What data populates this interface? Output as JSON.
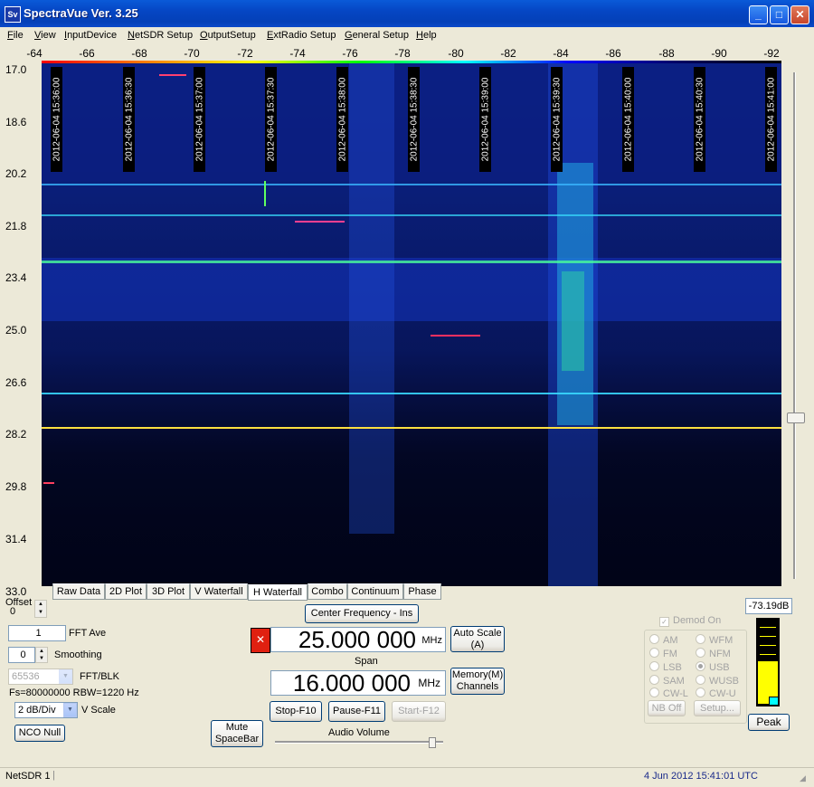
{
  "window": {
    "title": "SpectraVue Ver. 3.25",
    "icon_text": "Sv"
  },
  "menu": [
    {
      "key": "F",
      "rest": "ile"
    },
    {
      "key": "V",
      "rest": "iew"
    },
    {
      "key": "I",
      "rest": "nputDevice"
    },
    {
      "key": "N",
      "rest": "etSDR Setup"
    },
    {
      "key": "O",
      "rest": "utputSetup"
    },
    {
      "key": "E",
      "rest": "xtRadio Setup"
    },
    {
      "key": "G",
      "rest": "eneral Setup"
    },
    {
      "key": "H",
      "rest": "elp"
    }
  ],
  "db_axis": [
    "-64",
    "-66",
    "-68",
    "-70",
    "-72",
    "-74",
    "-76",
    "-78",
    "-80",
    "-82",
    "-84",
    "-86",
    "-88",
    "-90",
    "-92"
  ],
  "freq_axis": [
    "17.0",
    "18.6",
    "20.2",
    "21.8",
    "23.4",
    "25.0",
    "26.6",
    "28.2",
    "29.8",
    "31.4",
    "33.0"
  ],
  "timestamps": [
    "2012-06-04 15:36:00",
    "2012-06-04 15:36:30",
    "2012-06-04 15:37:00",
    "2012-06-04 15:37:30",
    "2012-06-04 15:38:00",
    "2012-06-04 15:38:30",
    "2012-06-04 15:39:00",
    "2012-06-04 15:39:30",
    "2012-06-04 15:40:00",
    "2012-06-04 15:40:30",
    "2012-06-04 15:41:00"
  ],
  "tabs": [
    "Raw Data",
    "2D Plot",
    "3D Plot",
    "V Waterfall",
    "H Waterfall",
    "Combo",
    "Continuum",
    "Phase"
  ],
  "active_tab": "H Waterfall",
  "offset": {
    "label": "Offset",
    "value": "0"
  },
  "fft_ave": {
    "value": "1",
    "label": "FFT Ave"
  },
  "smoothing": {
    "value": "0",
    "label": "Smoothing"
  },
  "fft_blk": {
    "value": "65536",
    "label": "FFT/BLK"
  },
  "fs_info": "Fs=80000000 RBW=1220 Hz",
  "vscale": {
    "value": "2 dB/Div",
    "label": "V Scale"
  },
  "nco_null": "NCO Null",
  "mute": {
    "line1": "Mute",
    "line2": "SpaceBar"
  },
  "center_freq": {
    "button": "Center Frequency - Ins",
    "value": "25.000 000",
    "unit": "MHz"
  },
  "span": {
    "label": "Span",
    "value": "16.000 000",
    "unit": "MHz"
  },
  "auto_scale": {
    "line1": "Auto Scale",
    "line2": "(A)"
  },
  "memory": {
    "line1": "Memory(M)",
    "line2": "Channels"
  },
  "controls": {
    "stop": "Stop-F10",
    "pause": "Pause-F11",
    "start": "Start-F12"
  },
  "audio_volume": "Audio Volume",
  "level_readout": "-73.19dB",
  "demod": {
    "label": "Demod On",
    "modes_left": [
      "AM",
      "FM",
      "LSB",
      "SAM",
      "CW-L"
    ],
    "modes_right": [
      "WFM",
      "NFM",
      "USB",
      "WUSB",
      "CW-U"
    ],
    "selected": "USB",
    "nb_off": "NB Off",
    "setup": "Setup..."
  },
  "peak": "Peak",
  "status": {
    "device": "NetSDR 1",
    "datetime": "4 Jun 2012  15:41:01 UTC"
  }
}
